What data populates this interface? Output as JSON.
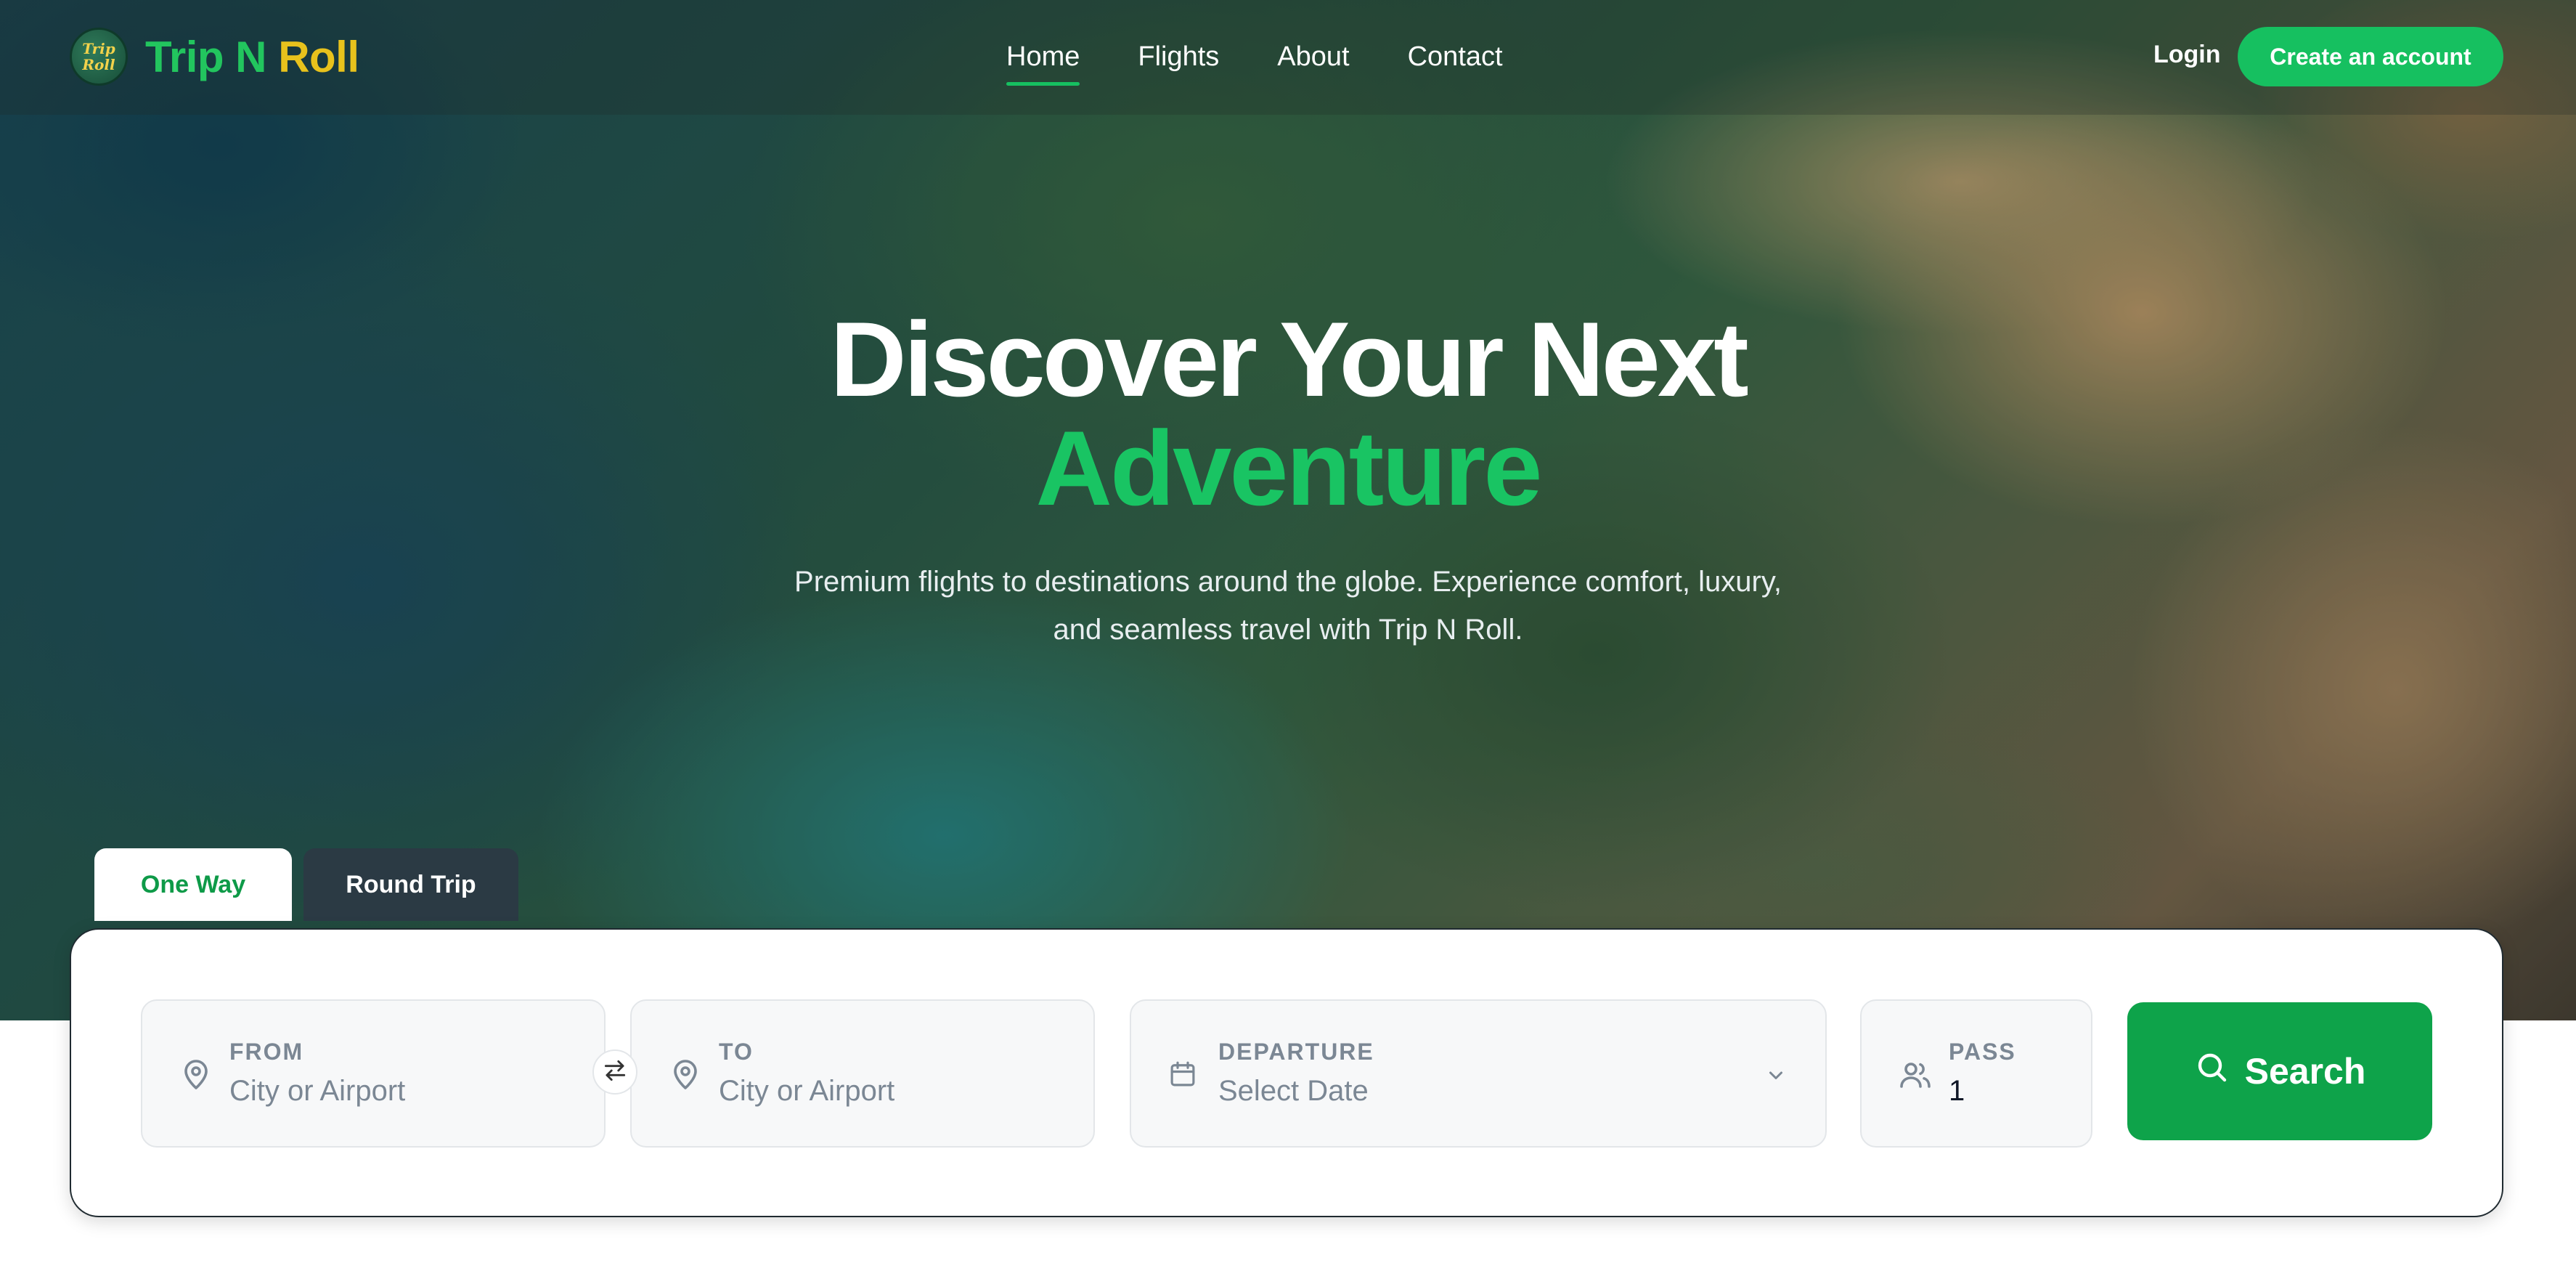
{
  "brand": {
    "logo_text_top": "Trip",
    "logo_text_bottom": "Roll",
    "name_part1": "Trip N",
    "name_part2": "Roll",
    "colors": {
      "green": "#22c55e",
      "yellow": "#e8c21c"
    }
  },
  "nav": {
    "links": [
      {
        "label": "Home",
        "active": true
      },
      {
        "label": "Flights",
        "active": false
      },
      {
        "label": "About",
        "active": false
      },
      {
        "label": "Contact",
        "active": false
      }
    ],
    "login_label": "Login",
    "create_account_label": "Create an account"
  },
  "hero": {
    "title_line1": "Discover Your Next",
    "title_line2": "Adventure",
    "subtitle": "Premium flights to destinations around the globe. Experience comfort, luxury, and seamless travel with Trip N Roll."
  },
  "trip_tabs": [
    {
      "label": "One Way",
      "active": true
    },
    {
      "label": "Round Trip",
      "active": false
    }
  ],
  "search": {
    "from": {
      "label": "FROM",
      "placeholder": "City or Airport",
      "icon": "map-pin-icon"
    },
    "to": {
      "label": "TO",
      "placeholder": "City or Airport",
      "icon": "map-pin-icon"
    },
    "swap_icon": "swap-arrows-icon",
    "departure": {
      "label": "DEPARTURE",
      "placeholder": "Select Date",
      "icon": "calendar-icon"
    },
    "passengers": {
      "label": "PASS",
      "value": "1",
      "icon": "users-icon"
    },
    "button_label": "Search",
    "button_icon": "search-icon"
  },
  "accent_color": "#16c060"
}
